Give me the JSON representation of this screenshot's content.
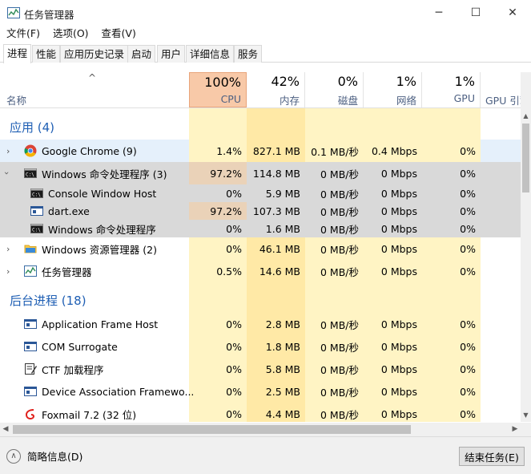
{
  "window": {
    "title": "任务管理器",
    "minimize_glyph": "─",
    "maximize_glyph": "☐",
    "close_glyph": "✕"
  },
  "menu": [
    "文件(F)",
    "选项(O)",
    "查看(V)"
  ],
  "tabs": [
    "进程",
    "性能",
    "应用历史记录",
    "启动",
    "用户",
    "详细信息",
    "服务"
  ],
  "columns": {
    "name": "名称",
    "sort_glyph": "^",
    "cpu": {
      "pct": "100%",
      "label": "CPU"
    },
    "mem": {
      "pct": "42%",
      "label": "内存"
    },
    "disk": {
      "pct": "0%",
      "label": "磁盘"
    },
    "net": {
      "pct": "1%",
      "label": "网络"
    },
    "gpu": {
      "pct": "1%",
      "label": "GPU"
    },
    "gpu_engine": {
      "label": "GPU 引擎"
    }
  },
  "groups": {
    "apps": "应用 (4)",
    "background": "后台进程 (18)"
  },
  "rows": [
    {
      "name": "Google Chrome (9)",
      "icon": "chrome-icon",
      "cpu": "1.4%",
      "mem": "827.1 MB",
      "disk": "0.1 MB/秒",
      "net": "0.4 Mbps",
      "gpu": "0%"
    },
    {
      "name": "Windows 命令处理程序 (3)",
      "icon": "console-icon",
      "cpu": "97.2%",
      "mem": "114.8 MB",
      "disk": "0 MB/秒",
      "net": "0 Mbps",
      "gpu": "0%"
    },
    {
      "name": "Console Window Host",
      "icon": "console-icon",
      "cpu": "0%",
      "mem": "5.9 MB",
      "disk": "0 MB/秒",
      "net": "0 Mbps",
      "gpu": "0%"
    },
    {
      "name": "dart.exe",
      "icon": "app-window-icon",
      "cpu": "97.2%",
      "mem": "107.3 MB",
      "disk": "0 MB/秒",
      "net": "0 Mbps",
      "gpu": "0%"
    },
    {
      "name": "Windows 命令处理程序",
      "icon": "console-icon",
      "cpu": "0%",
      "mem": "1.6 MB",
      "disk": "0 MB/秒",
      "net": "0 Mbps",
      "gpu": "0%"
    },
    {
      "name": "Windows 资源管理器 (2)",
      "icon": "folder-icon",
      "cpu": "0%",
      "mem": "46.1 MB",
      "disk": "0 MB/秒",
      "net": "0 Mbps",
      "gpu": "0%"
    },
    {
      "name": "任务管理器",
      "icon": "task-manager-icon",
      "cpu": "0.5%",
      "mem": "14.6 MB",
      "disk": "0 MB/秒",
      "net": "0 Mbps",
      "gpu": "0%"
    },
    {
      "name": "Application Frame Host",
      "icon": "app-window-icon",
      "cpu": "0%",
      "mem": "2.8 MB",
      "disk": "0 MB/秒",
      "net": "0 Mbps",
      "gpu": "0%"
    },
    {
      "name": "COM Surrogate",
      "icon": "app-window-icon",
      "cpu": "0%",
      "mem": "1.8 MB",
      "disk": "0 MB/秒",
      "net": "0 Mbps",
      "gpu": "0%"
    },
    {
      "name": "CTF 加载程序",
      "icon": "ctf-icon",
      "cpu": "0%",
      "mem": "5.8 MB",
      "disk": "0 MB/秒",
      "net": "0 Mbps",
      "gpu": "0%"
    },
    {
      "name": "Device Association Framewo...",
      "icon": "app-window-icon",
      "cpu": "0%",
      "mem": "2.5 MB",
      "disk": "0 MB/秒",
      "net": "0 Mbps",
      "gpu": "0%"
    },
    {
      "name": "Foxmail 7.2 (32 位)",
      "icon": "foxmail-icon",
      "cpu": "0%",
      "mem": "4.4 MB",
      "disk": "0 MB/秒",
      "net": "0 Mbps",
      "gpu": "0%"
    }
  ],
  "footer": {
    "fewer_details": "简略信息(D)",
    "end_task": "结束任务(E)"
  },
  "colors": {
    "cpu_header_bg": "#f8c9a8",
    "cpu_hot_bg": "#f2d5b8",
    "heat_light": "#fff4c4",
    "heat_mem": "#ffe9a6",
    "group_title": "#1f5fb4",
    "selected_bg": "#d9d9d9",
    "hover_bg": "#e5f0fb"
  }
}
